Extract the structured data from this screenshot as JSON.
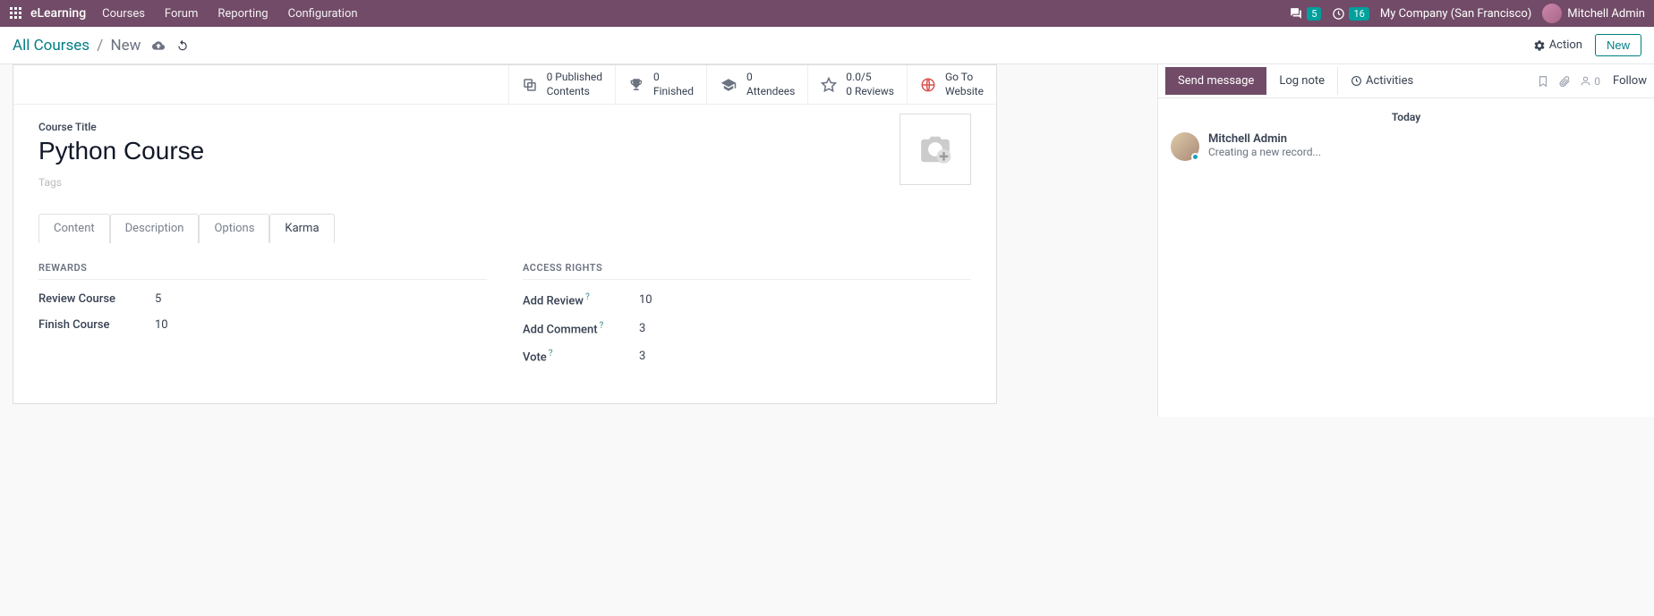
{
  "nav": {
    "brand": "eLearning",
    "items": [
      "Courses",
      "Forum",
      "Reporting",
      "Configuration"
    ],
    "messages_count": "5",
    "activities_count": "16",
    "company": "My Company (San Francisco)",
    "user": "Mitchell Admin"
  },
  "breadcrumb": {
    "root": "All Courses",
    "current": "New"
  },
  "controls": {
    "action": "Action",
    "new": "New"
  },
  "stats": {
    "published_line1": "0 Published",
    "published_line2": "Contents",
    "finished_line1": "0",
    "finished_line2": "Finished",
    "attendees_line1": "0",
    "attendees_line2": "Attendees",
    "rating_line1": "0.0/5",
    "rating_line2": "0 Reviews",
    "website_line1": "Go To",
    "website_line2": "Website"
  },
  "form": {
    "title_label": "Course Title",
    "title_value": "Python Course",
    "tags_placeholder": "Tags"
  },
  "tabs": [
    "Content",
    "Description",
    "Options",
    "Karma"
  ],
  "karma": {
    "rewards_title": "REWARDS",
    "review_course_label": "Review Course",
    "review_course_value": "5",
    "finish_course_label": "Finish Course",
    "finish_course_value": "10",
    "access_title": "ACCESS RIGHTS",
    "add_review_label": "Add Review",
    "add_review_value": "10",
    "add_comment_label": "Add Comment",
    "add_comment_value": "3",
    "vote_label": "Vote",
    "vote_value": "3"
  },
  "chatter": {
    "send": "Send message",
    "log": "Log note",
    "activities": "Activities",
    "followers": "0",
    "follow": "Follow",
    "date": "Today",
    "msg_author": "Mitchell Admin",
    "msg_body": "Creating a new record..."
  }
}
